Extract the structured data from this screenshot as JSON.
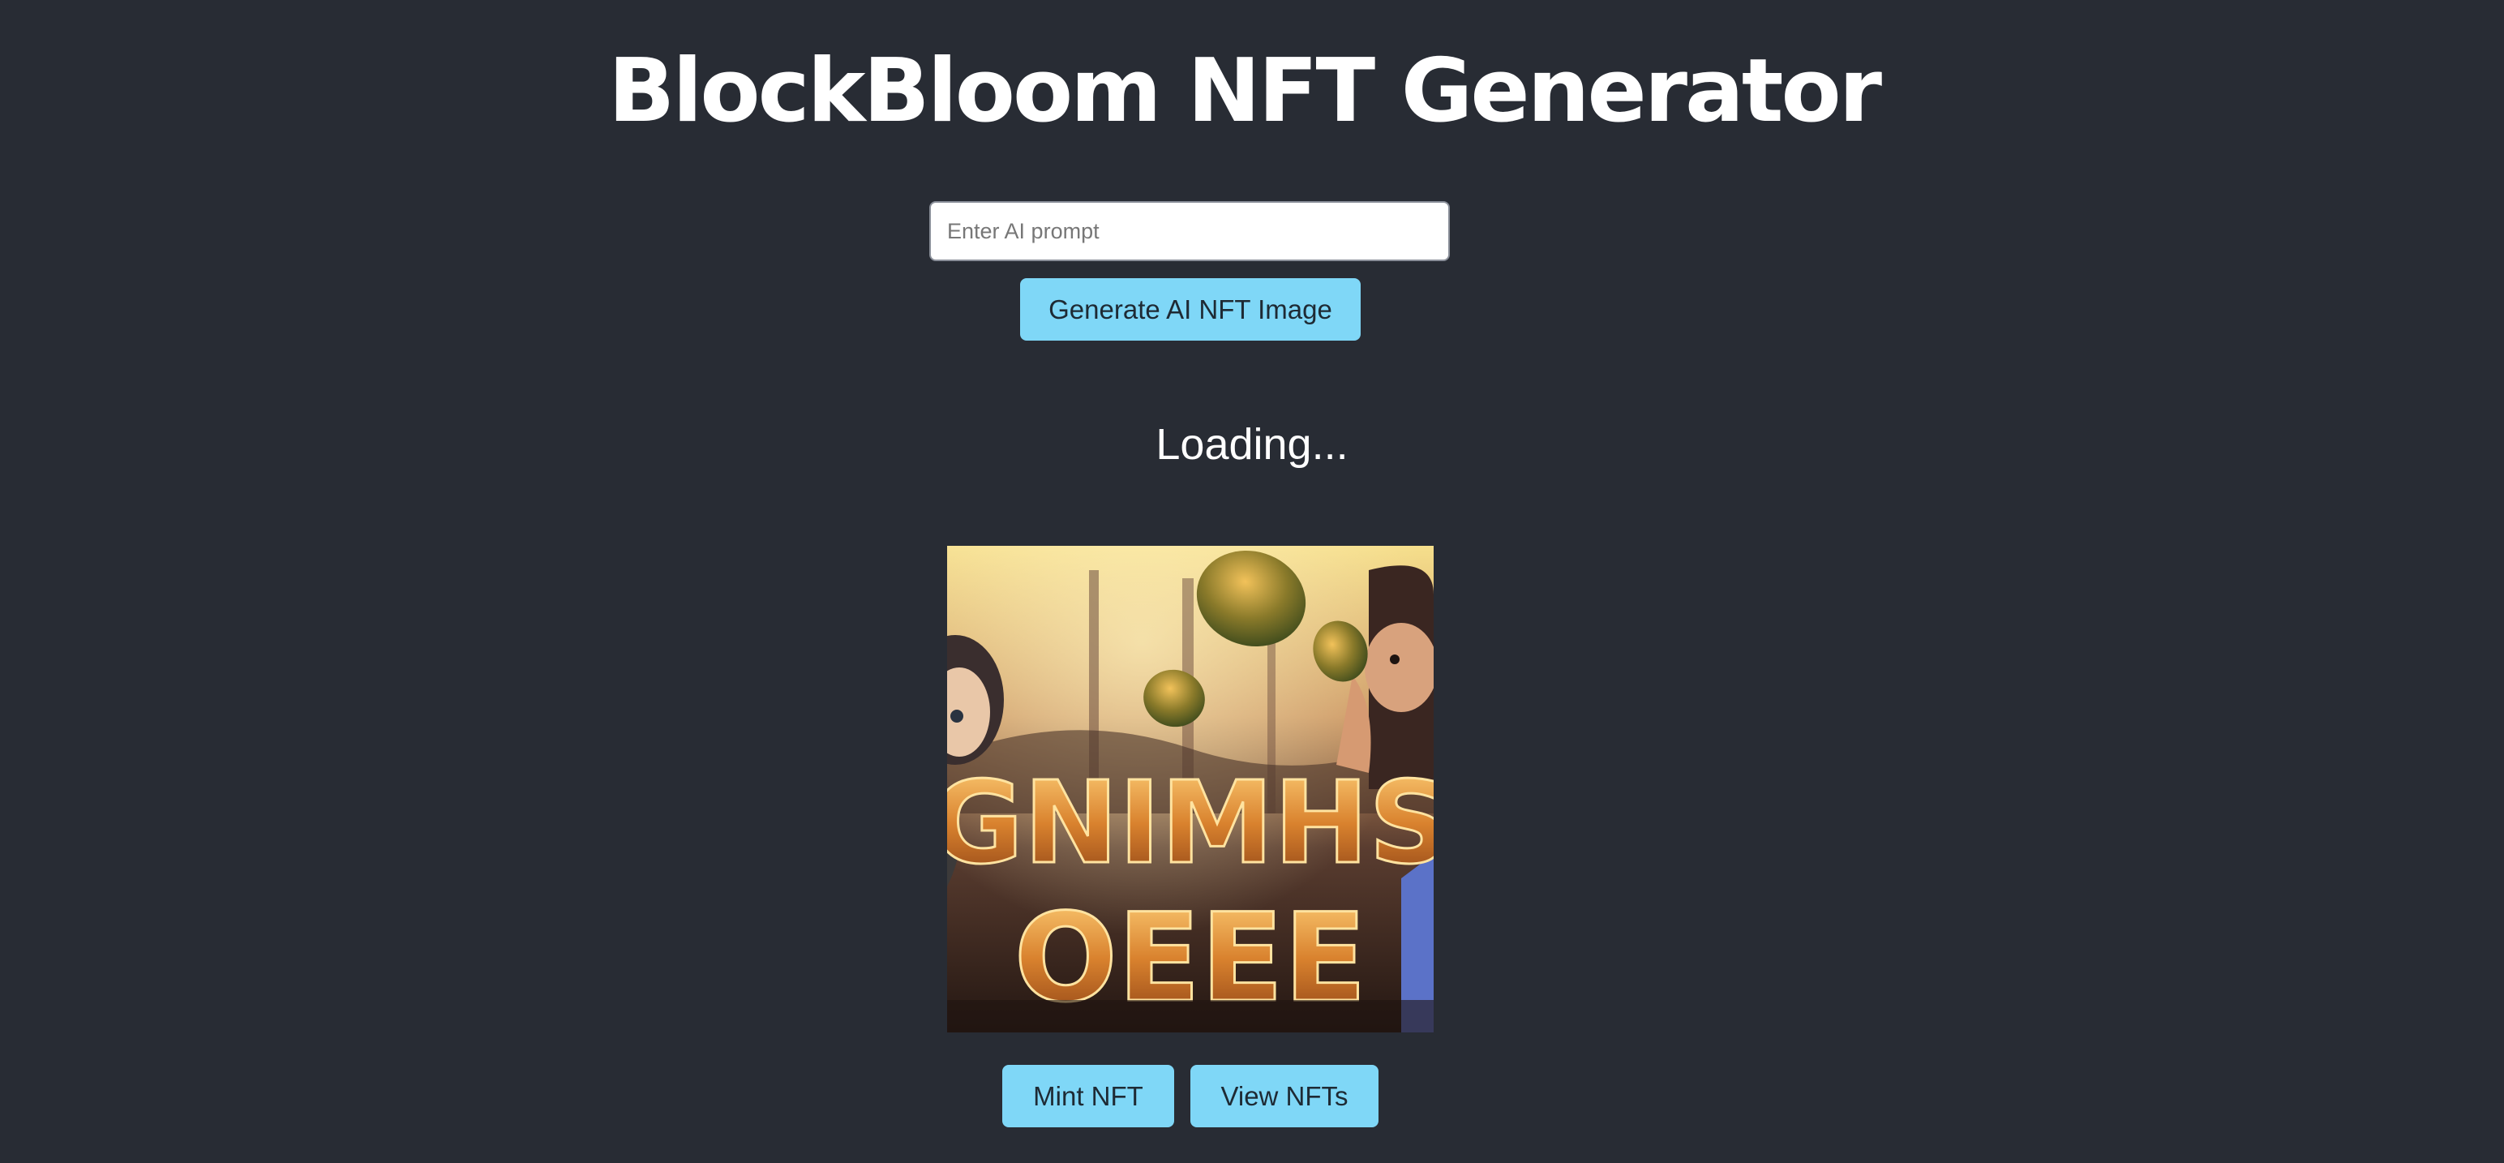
{
  "header": {
    "title": "BlockBloom NFT Generator"
  },
  "prompt": {
    "placeholder": "Enter AI prompt",
    "value": ""
  },
  "actions": {
    "generate_label": "Generate AI NFT Image",
    "mint_label": "Mint NFT",
    "view_label": "View NFTs"
  },
  "status": {
    "text": "Loading..."
  },
  "nft": {
    "image_alt": "Generated NFT image",
    "artwork_text_line1": "GNIMHS",
    "artwork_text_line2": "OEEE"
  },
  "colors": {
    "background": "#282c34",
    "button": "#7fd7f7",
    "button_text": "#1e2a34",
    "title_text": "#ffffff"
  }
}
